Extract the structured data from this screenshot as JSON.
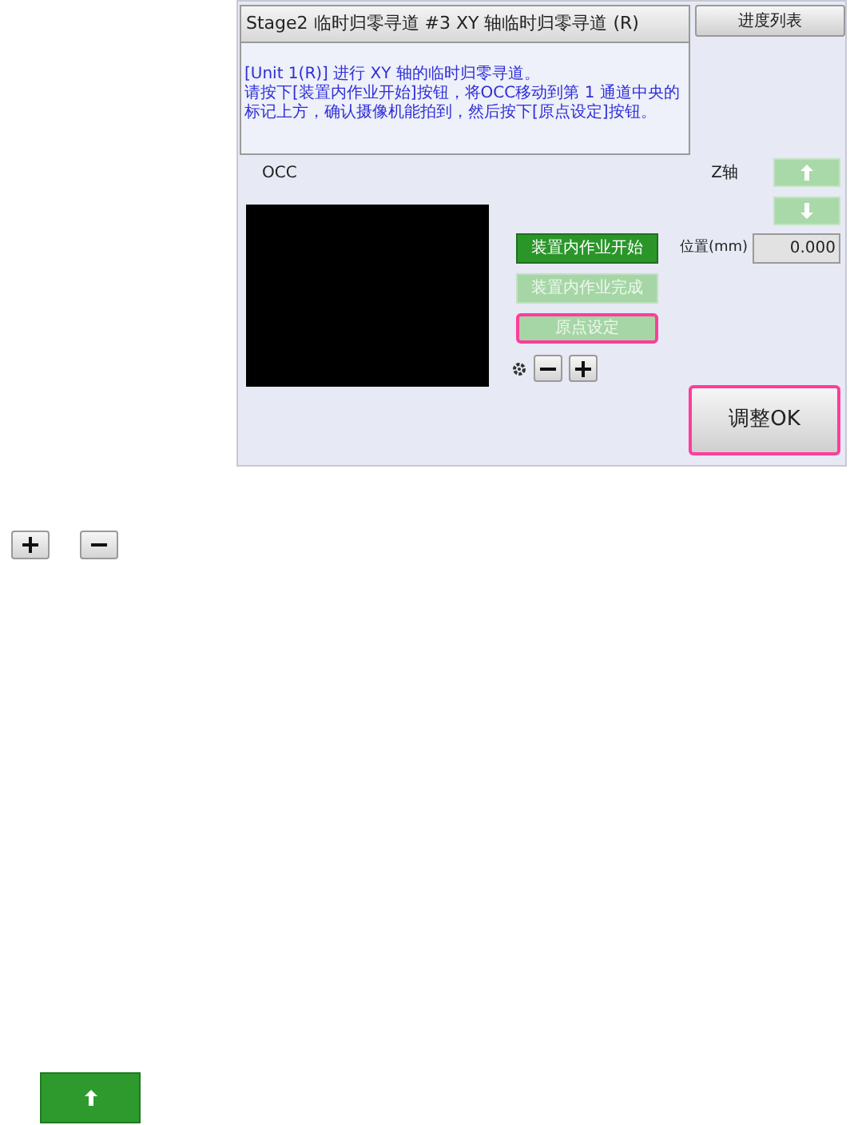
{
  "panel": {
    "title": "Stage2 临时归零寻道 #3 XY 轴临时归零寻道 (R)",
    "progress_button": "进度列表",
    "message": [
      "[Unit 1(R)] 进行 XY 轴的临时归零寻道。",
      "请按下[装置内作业开始]按钮，将OCC移动到第 1 通道中央的标记上方，确认摄像机能拍到，然后按下[原点设定]按钮。"
    ],
    "camera_label": "OCC",
    "work_buttons": [
      {
        "label": "装置内作业开始",
        "enabled": true,
        "highlighted": false
      },
      {
        "label": "装置内作业完成",
        "enabled": false,
        "highlighted": false
      },
      {
        "label": "原点设定",
        "enabled": false,
        "highlighted": true
      }
    ],
    "zoom_buttons": [
      {
        "kind": "minus"
      },
      {
        "kind": "plus"
      }
    ],
    "z_axis": {
      "label": "Z轴",
      "buttons": [
        {
          "kind": "up",
          "enabled": false
        },
        {
          "kind": "down",
          "enabled": false
        }
      ],
      "position_label": "位置(mm)",
      "position_value": "0.000"
    },
    "ok_button": {
      "label": "调整OK",
      "highlighted": true
    }
  },
  "legend_icons": [
    {
      "kind": "plus"
    },
    {
      "kind": "minus"
    }
  ],
  "sample_button": {
    "kind": "up",
    "enabled": true
  }
}
